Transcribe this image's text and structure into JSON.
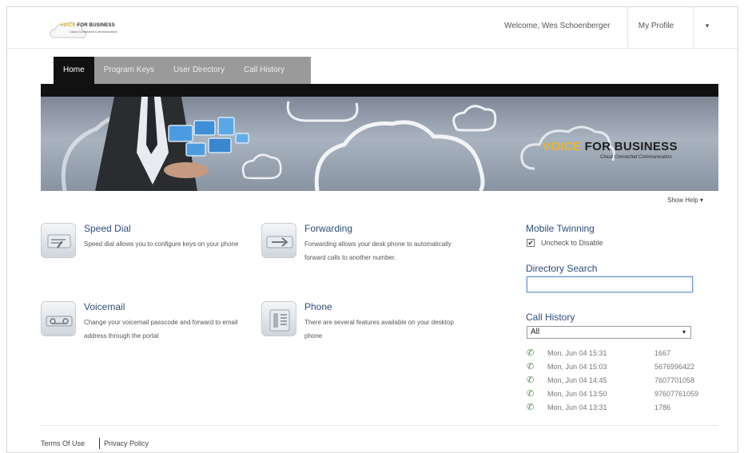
{
  "header": {
    "logo_text_highlight": "VOICE",
    "logo_text": "FOR BUSINESS",
    "logo_sub": "Cloud Connected Communication",
    "welcome": "Welcome, Wes Schoenberger",
    "my_profile": "My Profile",
    "menu_caret": "▾"
  },
  "tabs": [
    {
      "label": "Home",
      "active": true
    },
    {
      "label": "Program Keys",
      "active": false
    },
    {
      "label": "User Directory",
      "active": false
    },
    {
      "label": "Call History",
      "active": false
    }
  ],
  "banner": {
    "brand_highlight": "VOICE",
    "brand_text": "FOR BUSINESS",
    "brand_sub": "Cloud Connected Communication"
  },
  "show_help": "Show Help ▾",
  "features": [
    {
      "title": "Speed Dial",
      "desc": "Speed dial allows you to configure keys on your phone",
      "icon": "speed-dial-icon"
    },
    {
      "title": "Forwarding",
      "desc": "Forwarding allows your desk phone to automatically forward calls to another number.",
      "icon": "forwarding-icon"
    },
    {
      "title": "Voicemail",
      "desc": "Change your voicemail passcode and forward to email address through the portal",
      "icon": "voicemail-icon"
    },
    {
      "title": "Phone",
      "desc": "There are several features available on your desktop phone",
      "icon": "phone-icon"
    }
  ],
  "right": {
    "mobile_twinning": "Mobile Twinning",
    "uncheck_label": "Uncheck to Disable",
    "checkbox_mark": "✔",
    "directory_search": "Directory Search",
    "search_value": "",
    "call_history": "Call History",
    "filter_value": "All",
    "filter_arrow": "▾",
    "calls": [
      {
        "date": "Mon, Jun 04 15:31",
        "number": "1667"
      },
      {
        "date": "Mon, Jun 04 15:03",
        "number": "5676996422"
      },
      {
        "date": "Mon, Jun 04 14:45",
        "number": "7607701058"
      },
      {
        "date": "Mon, Jun 04 13:50",
        "number": "97607761059"
      },
      {
        "date": "Mon, Jun 04 13:31",
        "number": "1786"
      }
    ]
  },
  "footer": {
    "terms": "Terms Of Use",
    "privacy": "Privacy Policy"
  },
  "colors": {
    "accent": "#2e4d7a",
    "brand_yellow": "#e8b52a",
    "tab_active": "#111111",
    "tab_inactive": "#9a9a9a"
  }
}
